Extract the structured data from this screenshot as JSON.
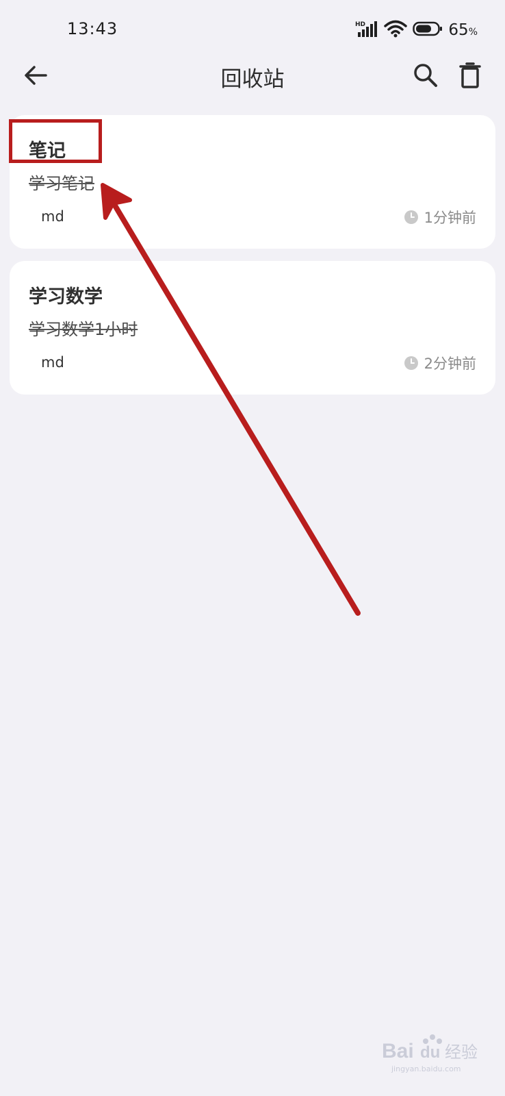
{
  "status_bar": {
    "time": "13:43",
    "network_label": "HD",
    "battery_value": "65",
    "battery_unit": "%"
  },
  "app_bar": {
    "title": "回收站",
    "icons": [
      "back-arrow-icon",
      "search-icon",
      "trash-icon"
    ]
  },
  "notes": [
    {
      "title": "笔记",
      "snippet": "学习笔记",
      "tag": "md",
      "time": "1分钟前"
    },
    {
      "title": "学习数学",
      "snippet": "学习数学1小时",
      "tag": "md",
      "time": "2分钟前"
    }
  ],
  "colors": {
    "background": "#f2f1f6",
    "card": "#ffffff",
    "annotation": "#b81d1d",
    "muted_text": "#8a8a8a"
  },
  "watermark": {
    "logo_text": "Bai du 经验",
    "site": "jingyan.baidu.com"
  }
}
